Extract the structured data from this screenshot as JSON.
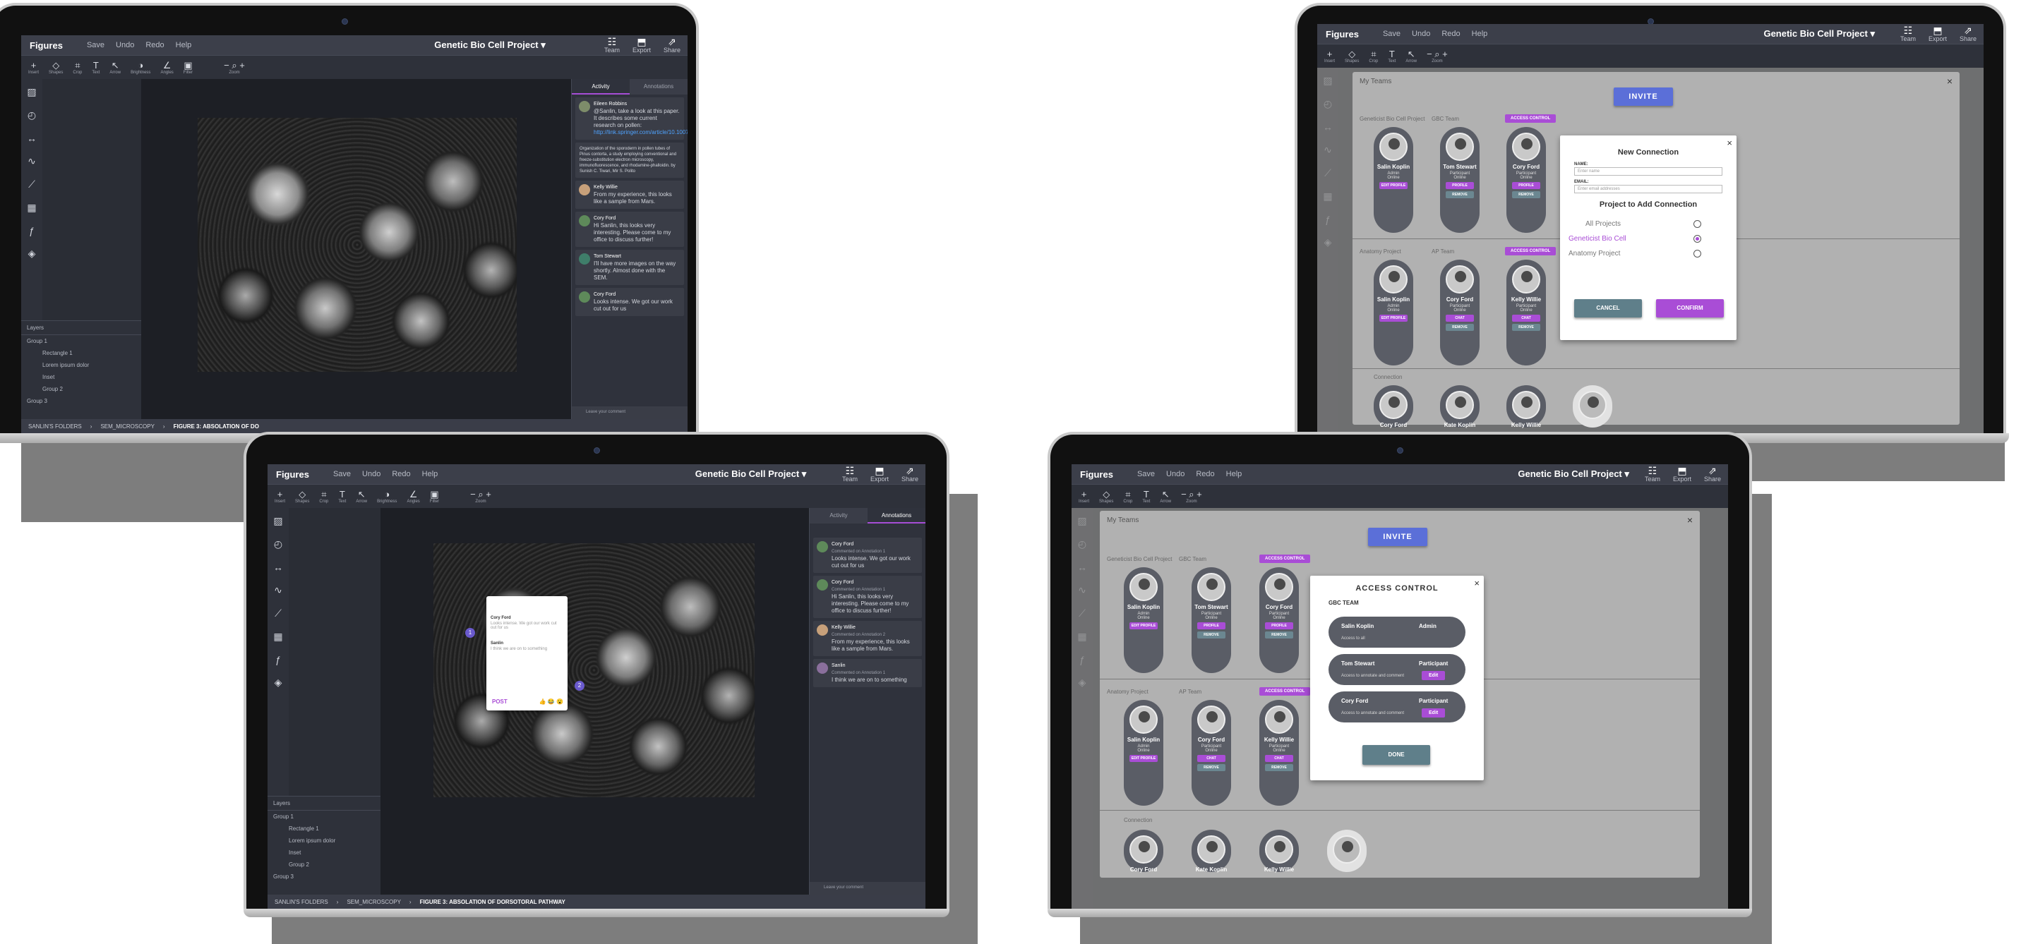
{
  "app": {
    "logo": "Figures",
    "menu": [
      "Save",
      "Undo",
      "Redo",
      "Help"
    ],
    "project": "Genetic Bio Cell Project ▾",
    "right_buttons": [
      "Team",
      "Export",
      "Share"
    ],
    "tools": [
      "Insert",
      "Shapes",
      "Crop",
      "Text",
      "Arrow",
      "Brightness",
      "Angles",
      "Filter",
      "Zoom"
    ]
  },
  "layers": {
    "header": "Layers",
    "rows": [
      "Group 1",
      "Rectangle 1",
      "Lorem ipsum dolor",
      "Inset",
      "Group 2",
      "Group 3"
    ]
  },
  "breadcrumb": [
    "SANLIN'S FOLDERS",
    "SEM_MICROSCOPY",
    "FIGURE 3: ABSOLATION OF DORSOTORAL PATHWAY"
  ],
  "breadcrumb_short": "FIGURE 3: ABSOLATION OF DO",
  "tabs": {
    "activity": "Activity",
    "annotations": "Annotations"
  },
  "activity": [
    {
      "name": "Eileen Robbins",
      "time": "5 minutes ago",
      "text": "@Sanlin, take a look at this paper. It describes some current research on pollen:",
      "link": "http://link.springer.com/article/10.1007/BF00..."
    },
    {
      "name": "",
      "time": "",
      "text": "Organization of the sporoderm in pollen tubes of Pinus contorta, a study employing conventional and freeze-substitution electron microscopy, immunofluorescence, and rhodamine-phalloidin. by Sunish C. Tiwari, Mir S. Polito",
      "link": ""
    },
    {
      "name": "Kelly Willie",
      "time": "2 hours ago",
      "text": "From my experience, this looks like a sample from Mars.",
      "link": ""
    },
    {
      "name": "Cory Ford",
      "time": "1 day ago",
      "text": "Hi Sanlin, this looks very interesting. Please come to my office to discuss further!",
      "link": ""
    },
    {
      "name": "Tom Stewart",
      "time": "30 minutes ago",
      "text": "I'll have more images on the way shortly. Almost done with the SEM.",
      "link": ""
    },
    {
      "name": "Cory Ford",
      "time": "10 minutes ago",
      "text": "Looks intense. We got our work cut out for us",
      "link": ""
    }
  ],
  "annotations": [
    {
      "name": "Cory Ford",
      "time": "10 minutes ago",
      "sub": "Commented on Annotation 1",
      "text": "Looks intense. We got our work cut out for us"
    },
    {
      "name": "Cory Ford",
      "time": "1 day ago",
      "sub": "Commented on Annotation 1",
      "text": "Hi Sanlin, this looks very interesting. Please come to my office to discuss further!"
    },
    {
      "name": "Kelly Willie",
      "time": "2 hours ago",
      "sub": "Commented on Annotation 2",
      "text": "From my experience, this looks like a sample from Mars."
    },
    {
      "name": "Sanlin",
      "time": "1 minute ago",
      "sub": "Commented on Annotation 1",
      "text": "I think we are on to something"
    }
  ],
  "comment_placeholder": "Leave your comment",
  "popup": {
    "post": "POST",
    "emoji": "👍 😂 😮",
    "comment_name": "Cory Ford",
    "comment_time": "10 minutes ago",
    "comment_text": "Looks intense. We got our work cut out for us",
    "me": "Sanlin",
    "me_time": "1 minute ago",
    "me_text": "I think we are on to something"
  },
  "teams": {
    "title": "My Teams",
    "invite": "INVITE",
    "access": "ACCESS CONTROL",
    "sections": [
      {
        "project": "Geneticist Bio Cell Project",
        "team": "GBC Team",
        "members": [
          {
            "name": "Salin Koplin",
            "role": "Admin",
            "status": "Online",
            "btn1": "EDIT PROFILE",
            "btn2": ""
          },
          {
            "name": "Tom Stewart",
            "role": "Participant",
            "status": "Online",
            "btn1": "PROFILE",
            "btn2": "REMOVE"
          },
          {
            "name": "Cory Ford",
            "role": "Participant",
            "status": "Online",
            "btn1": "PROFILE",
            "btn2": "REMOVE"
          }
        ]
      },
      {
        "project": "Anatomy Project",
        "team": "AP Team",
        "members": [
          {
            "name": "Salin Koplin",
            "role": "Admin",
            "status": "Online",
            "btn1": "EDIT PROFILE",
            "btn2": ""
          },
          {
            "name": "Cory Ford",
            "role": "Participant",
            "status": "Online",
            "btn1": "CHAT",
            "btn2": "REMOVE"
          },
          {
            "name": "Kelly Willie",
            "role": "Participant",
            "status": "Online",
            "btn1": "CHAT",
            "btn2": "REMOVE"
          }
        ]
      }
    ],
    "connection_title": "Connection",
    "connections": [
      "Cory Ford",
      "Kate Koplin",
      "Kelly Willie"
    ]
  },
  "new_connection": {
    "title": "New Connection",
    "name_label": "NAME:",
    "name_placeholder": "Enter name",
    "email_label": "EMAIL:",
    "email_placeholder": "Enter email addresses",
    "project_title": "Project to Add Connection",
    "options": [
      "All Projects",
      "Geneticist Bio Cell",
      "Anatomy Project"
    ],
    "cancel": "CANCEL",
    "confirm": "CONFIRM"
  },
  "access_control": {
    "title": "ACCESS CONTROL",
    "team": "GBC TEAM",
    "rows": [
      {
        "name": "Salin Koplin",
        "desc": "Access to all",
        "role": "Admin",
        "edit": ""
      },
      {
        "name": "Tom Stewart",
        "desc": "Access to annotate and comment",
        "role": "Participant",
        "edit": "Edit"
      },
      {
        "name": "Cory Ford",
        "desc": "Access to annotate and comment",
        "role": "Participant",
        "edit": "Edit"
      }
    ],
    "done": "DONE"
  },
  "colors": {
    "accent": "#a94dd6",
    "invite": "#5b6fd8",
    "panel": "#2f323c"
  }
}
